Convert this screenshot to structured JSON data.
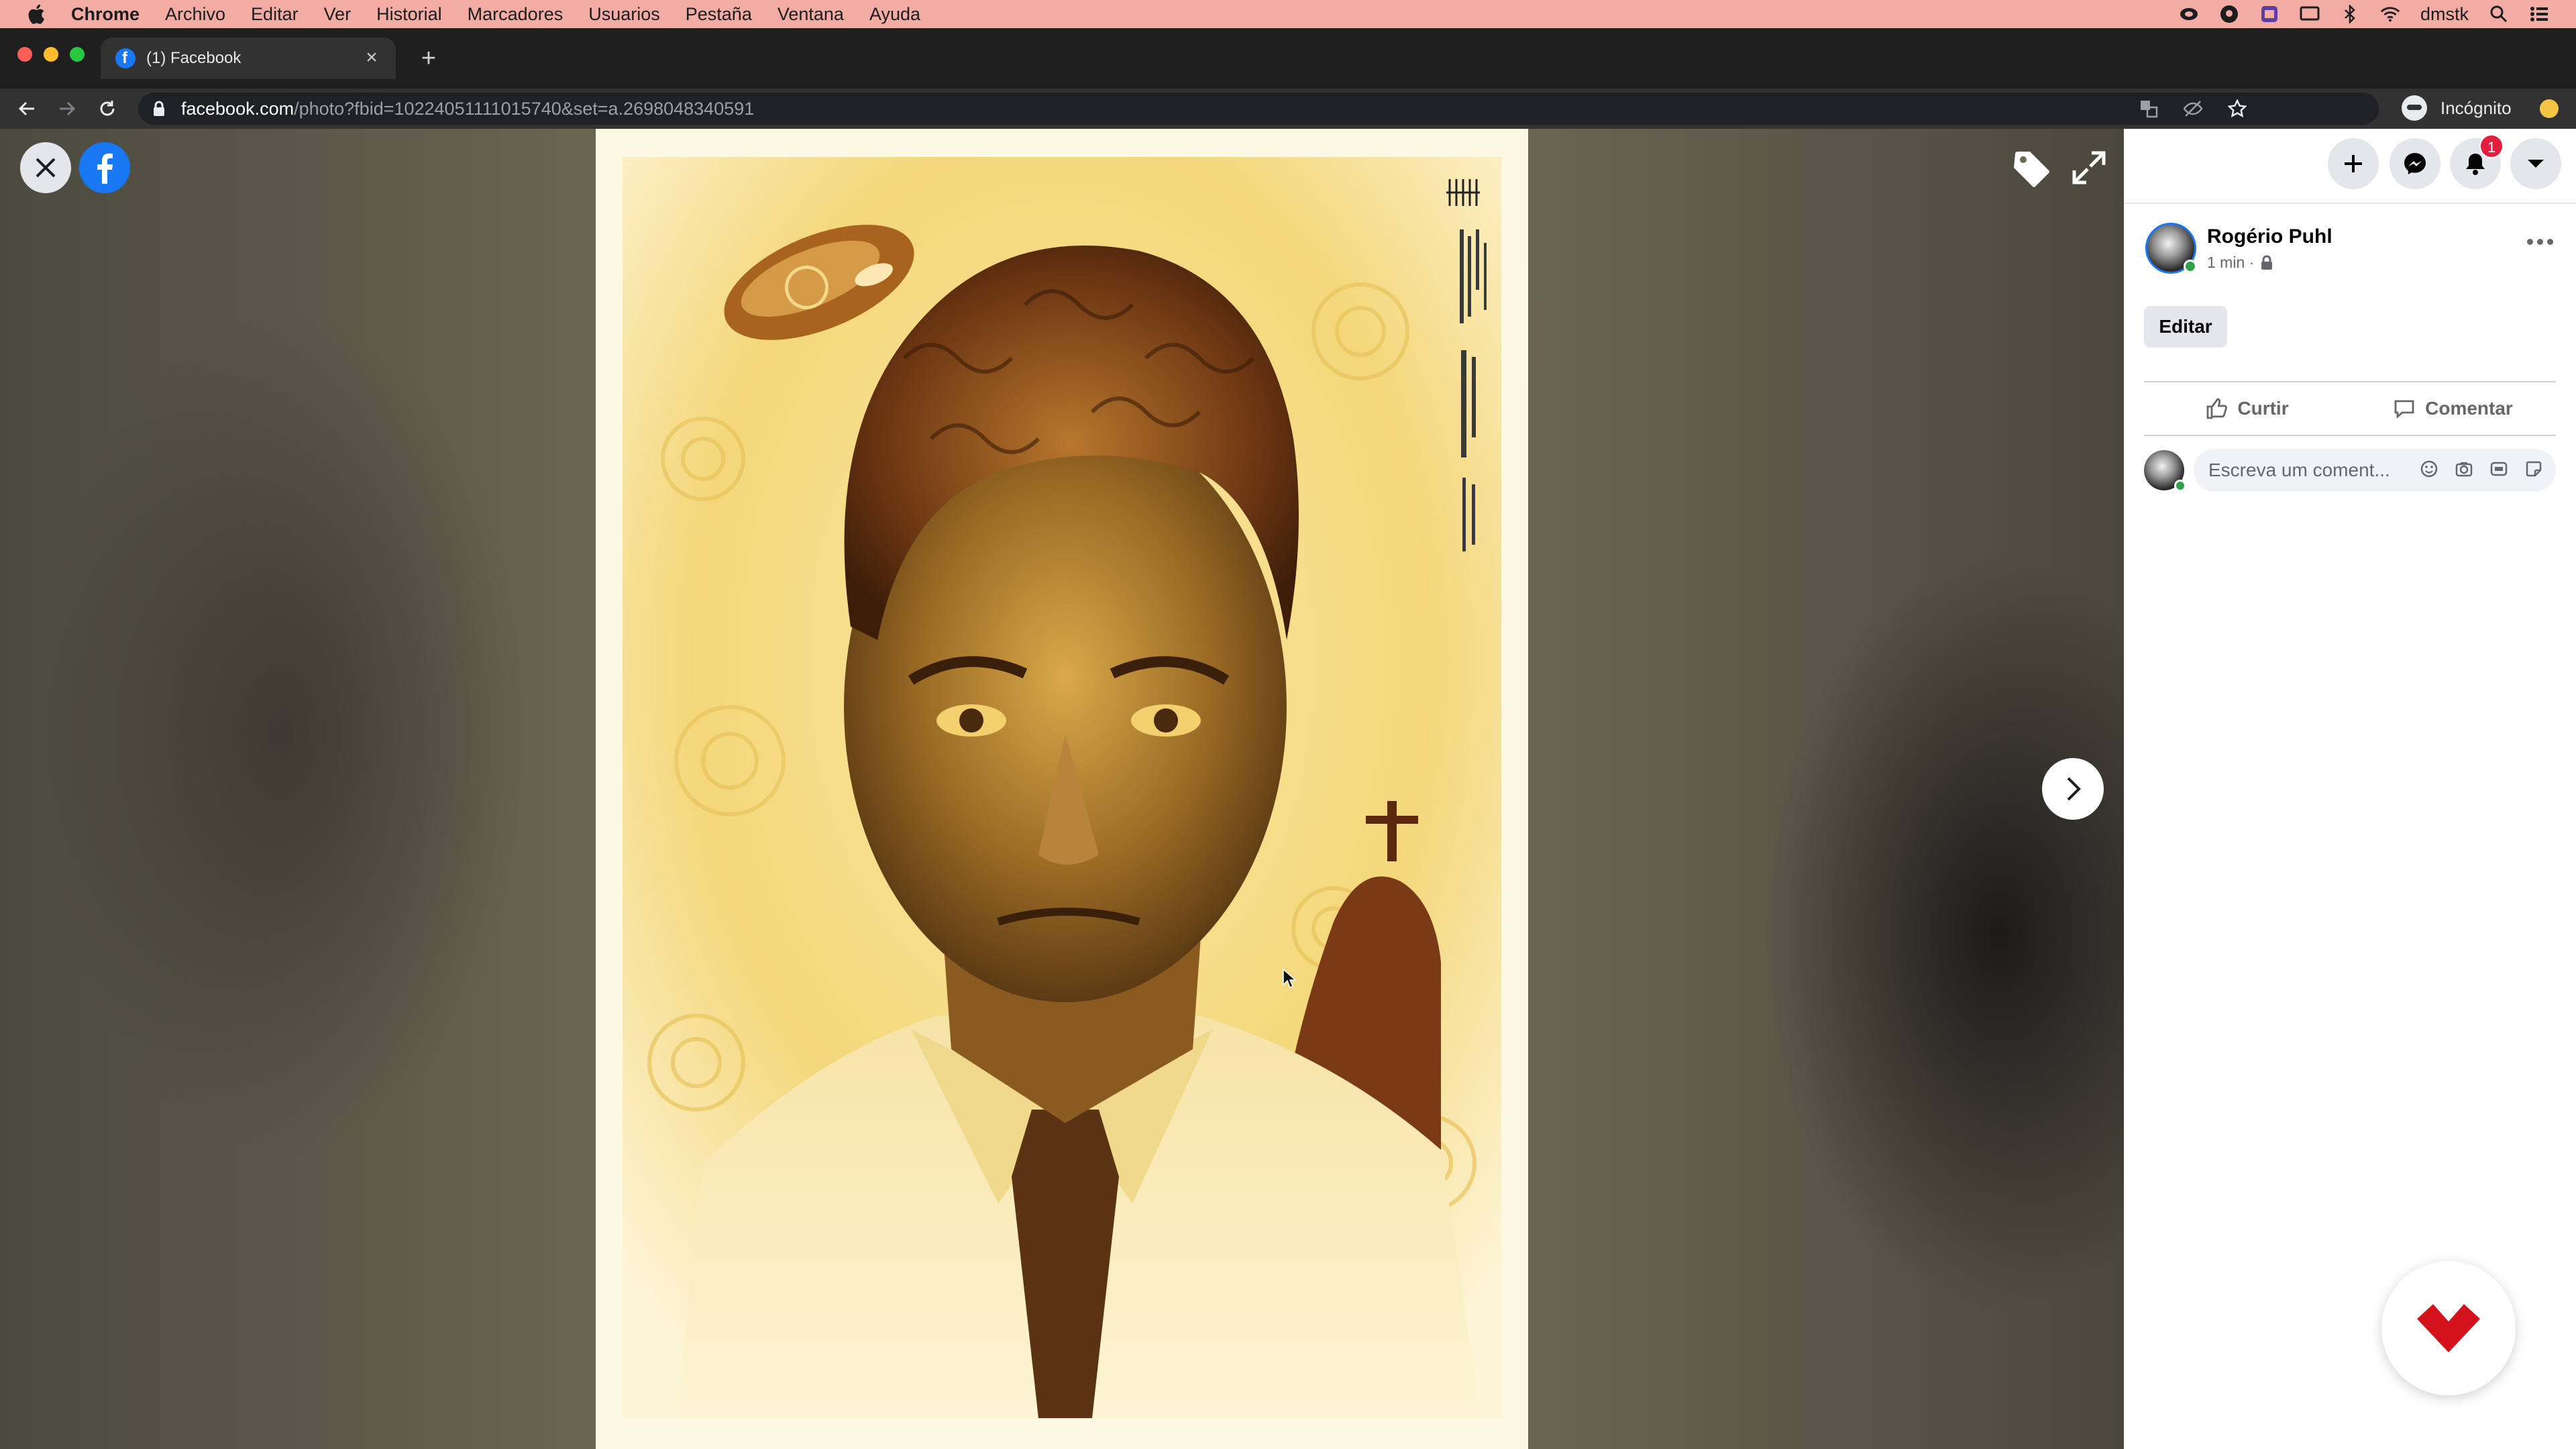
{
  "menubar": {
    "app": "Chrome",
    "items": [
      "Archivo",
      "Editar",
      "Ver",
      "Historial",
      "Marcadores",
      "Usuarios",
      "Pestaña",
      "Ventana",
      "Ayuda"
    ],
    "user": "dmstk",
    "status_icons": [
      "creative-cloud-icon",
      "github-icon",
      "screen-app-icon",
      "display-icon",
      "bluetooth-icon",
      "wifi-icon",
      "search-icon",
      "control-center-icon"
    ]
  },
  "tab": {
    "title": "(1) Facebook"
  },
  "omnibox": {
    "host": "facebook.com",
    "path": "/photo?fbid=10224051111015740&set=a.2698048340591"
  },
  "profile": {
    "label": "Incógnito"
  },
  "notifications": {
    "count": "1"
  },
  "post": {
    "author": "Rogério Puhl",
    "time": "1 min ·",
    "edit_label": "Editar",
    "like_label": "Curtir",
    "comment_label": "Comentar",
    "comment_placeholder": "Escreva um coment..."
  },
  "colors": {
    "facebook_blue": "#1877f2",
    "menubar": "#f2aca4",
    "badge_red": "#e41e3f",
    "fab_red": "#d3121b"
  }
}
